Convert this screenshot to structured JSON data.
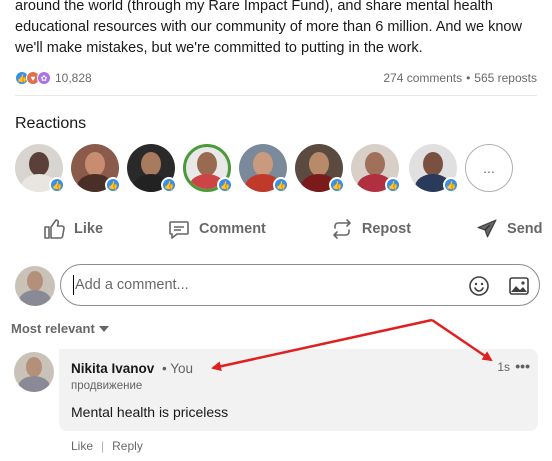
{
  "post": {
    "lines": [
      "around the world (through my Rare Impact Fund), and share mental health",
      "educational resources with our community of more than 6 million. And we know",
      "we'll make mistakes, but we're committed to putting in the work."
    ]
  },
  "social": {
    "reaction_count": "10,828",
    "comments": "274 comments",
    "dot": "•",
    "reposts": "565 reposts"
  },
  "reactions": {
    "title": "Reactions",
    "more": "..."
  },
  "actions": {
    "like": "Like",
    "comment": "Comment",
    "repost": "Repost",
    "send": "Send"
  },
  "comment_box": {
    "placeholder": "Add a comment..."
  },
  "sort": {
    "label": "Most relevant"
  },
  "comment": {
    "author": "Nikita Ivanov",
    "you": "• You",
    "subtitle": "продвижение",
    "text": "Mental health is priceless",
    "time": "1s",
    "more": "•••",
    "like": "Like",
    "separator": "|",
    "reply": "Reply"
  },
  "colors": {
    "annotation_arrow": "#e02020",
    "like_blue": "#378fe9"
  }
}
